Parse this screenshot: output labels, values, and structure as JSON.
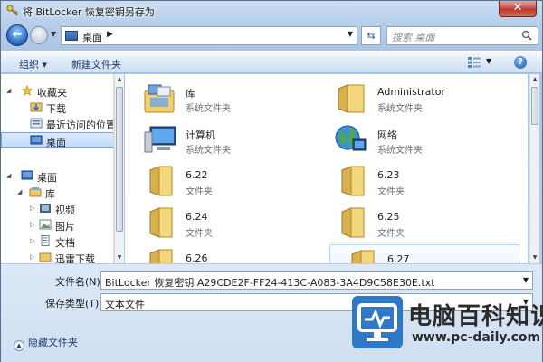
{
  "window": {
    "title": "将 BitLocker 恢复密钥另存为",
    "close_glyph": "✕"
  },
  "address": {
    "location": "桌面",
    "search_placeholder": "搜索 桌面"
  },
  "toolbar": {
    "organize": "组织 ▾",
    "new_folder": "新建文件夹"
  },
  "navigation": {
    "items": [
      {
        "label": "收藏夹",
        "icon": "star-icon",
        "level": 0,
        "expanded": true
      },
      {
        "label": "下载",
        "icon": "download-folder-icon",
        "level": 1
      },
      {
        "label": "最近访问的位置",
        "icon": "recent-places-icon",
        "level": 1
      },
      {
        "label": "桌面",
        "icon": "desktop-icon",
        "level": 1,
        "selected": true
      },
      {
        "label": "桌面",
        "icon": "desktop-icon",
        "level": 0,
        "expanded": true
      },
      {
        "label": "库",
        "icon": "library-icon",
        "level": 1,
        "expanded": true
      },
      {
        "label": "视频",
        "icon": "video-library-icon",
        "level": 2
      },
      {
        "label": "图片",
        "icon": "picture-library-icon",
        "level": 2
      },
      {
        "label": "文档",
        "icon": "document-library-icon",
        "level": 2
      },
      {
        "label": "迅雷下载",
        "icon": "folder-icon",
        "level": 2
      }
    ]
  },
  "content": {
    "items": [
      {
        "name": "库",
        "type": "系统文件夹",
        "icon": "library-icon"
      },
      {
        "name": "Administrator",
        "type": "系统文件夹",
        "icon": "user-folder-icon"
      },
      {
        "name": "计算机",
        "type": "系统文件夹",
        "icon": "computer-icon"
      },
      {
        "name": "网络",
        "type": "系统文件夹",
        "icon": "network-icon"
      },
      {
        "name": "6.22",
        "type": "文件夹",
        "icon": "folder-icon"
      },
      {
        "name": "6.23",
        "type": "文件夹",
        "icon": "folder-icon"
      },
      {
        "name": "6.24",
        "type": "文件夹",
        "icon": "folder-icon"
      },
      {
        "name": "6.25",
        "type": "文件夹",
        "icon": "folder-icon"
      },
      {
        "name": "6.26",
        "type": "",
        "icon": "folder-icon"
      },
      {
        "name": "6.27",
        "type": "",
        "icon": "folder-icon"
      }
    ]
  },
  "form": {
    "filename_label": "文件名(N):",
    "filename_value": "BitLocker 恢复密钥 A29CDE2F-FF24-413C-A083-3A4D9C58E30E.txt",
    "filetype_label": "保存类型(T):",
    "filetype_value": "文本文件",
    "hide_folders": "隐藏文件夹"
  },
  "watermark": {
    "title": "电脑百科知识",
    "url": "www.pc-daily.com"
  },
  "colors": {
    "accent": "#2f78c7",
    "selection": "#c1dbfc",
    "frame": "#b4cce8"
  }
}
